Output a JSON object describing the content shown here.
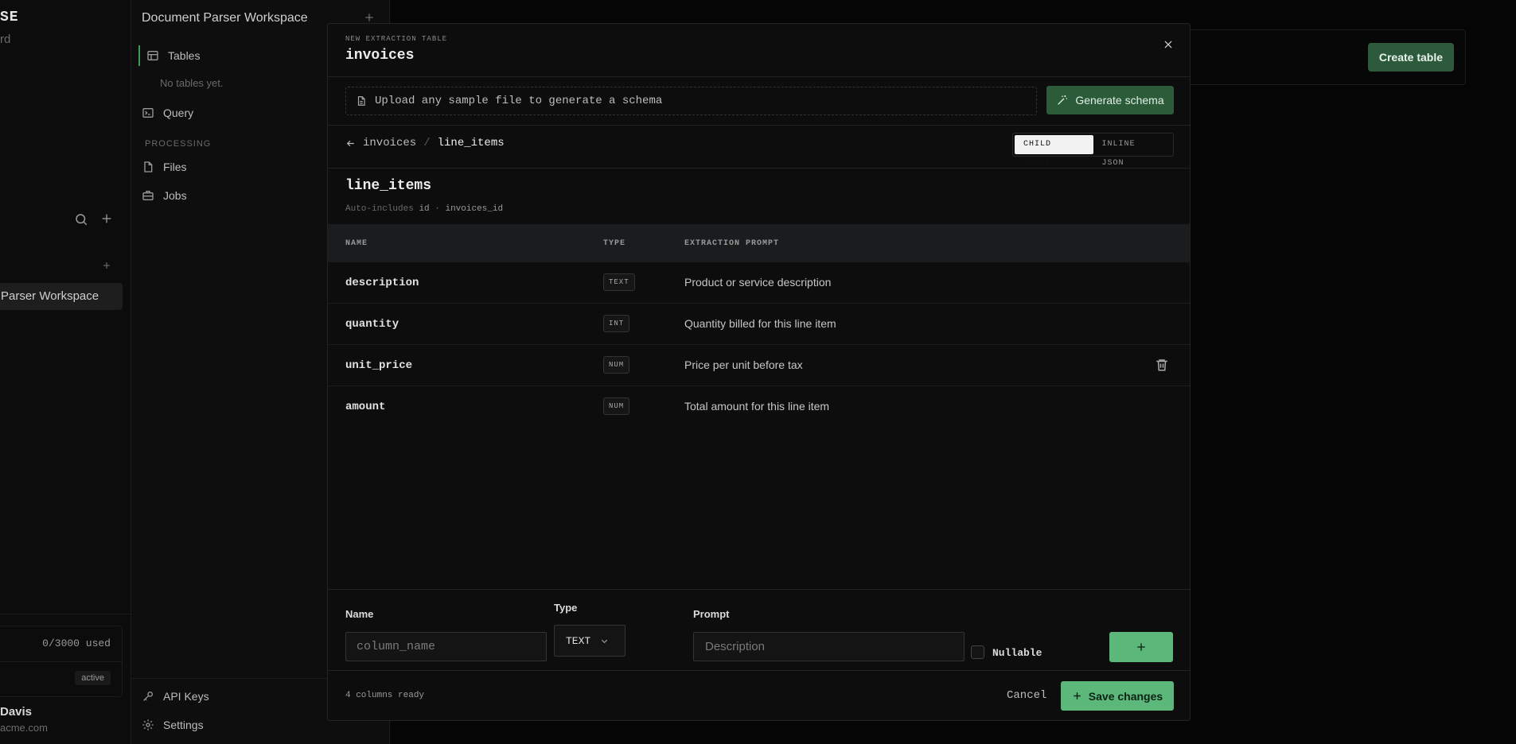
{
  "left_sidebar": {
    "brand_title": "SE",
    "brand_subtitle": "rd",
    "workspace_item": "Parser Workspace",
    "usage": "0/3000 used",
    "status_badge": "active",
    "user_name": "Davis",
    "user_email": "acme.com"
  },
  "nav_sidebar": {
    "workspace_title": "Document Parser Workspace",
    "items": [
      {
        "label": "Tables",
        "icon": "table-icon"
      },
      {
        "label": "Query",
        "icon": "terminal-icon"
      },
      {
        "label": "Files",
        "icon": "file-icon"
      },
      {
        "label": "Jobs",
        "icon": "briefcase-icon"
      }
    ],
    "empty_tables_text": "No tables yet.",
    "section_processing": "PROCESSING",
    "bottom_items": [
      {
        "label": "API Keys",
        "icon": "key-icon"
      },
      {
        "label": "Settings",
        "icon": "gear-icon"
      }
    ]
  },
  "background": {
    "create_table_label": "Create table"
  },
  "modal": {
    "eyebrow": "NEW EXTRACTION TABLE",
    "title": "invoices",
    "upload_text": "Upload any sample file to generate a schema",
    "generate_label": "Generate schema",
    "breadcrumb": {
      "parent": "invoices",
      "separator": "/",
      "current": "line_items"
    },
    "mode_options": [
      "CHILD TABLE",
      "INLINE JSON"
    ],
    "mode_selected": "CHILD TABLE",
    "subtable_title": "line_items",
    "auto_includes": {
      "prefix": "Auto-includes",
      "col1": "id",
      "dot": "·",
      "col2": "invoices_id"
    },
    "columns_header": {
      "name": "NAME",
      "type": "TYPE",
      "prompt": "EXTRACTION PROMPT"
    },
    "rows": [
      {
        "name": "description",
        "type": "TEXT",
        "prompt": "Product or service description"
      },
      {
        "name": "quantity",
        "type": "INT",
        "prompt": "Quantity billed for this line item"
      },
      {
        "name": "unit_price",
        "type": "NUM",
        "prompt": "Price per unit before tax"
      },
      {
        "name": "amount",
        "type": "NUM",
        "prompt": "Total amount for this line item"
      }
    ],
    "form": {
      "name_label": "Name",
      "name_placeholder": "column_name",
      "type_label": "Type",
      "type_value": "TEXT",
      "prompt_label": "Prompt",
      "prompt_placeholder": "Description",
      "nullable_label": "Nullable"
    },
    "footer": {
      "count_text": "4 columns ready",
      "cancel_label": "Cancel",
      "save_label": "Save changes"
    },
    "accent_color": "#5cb87a"
  }
}
